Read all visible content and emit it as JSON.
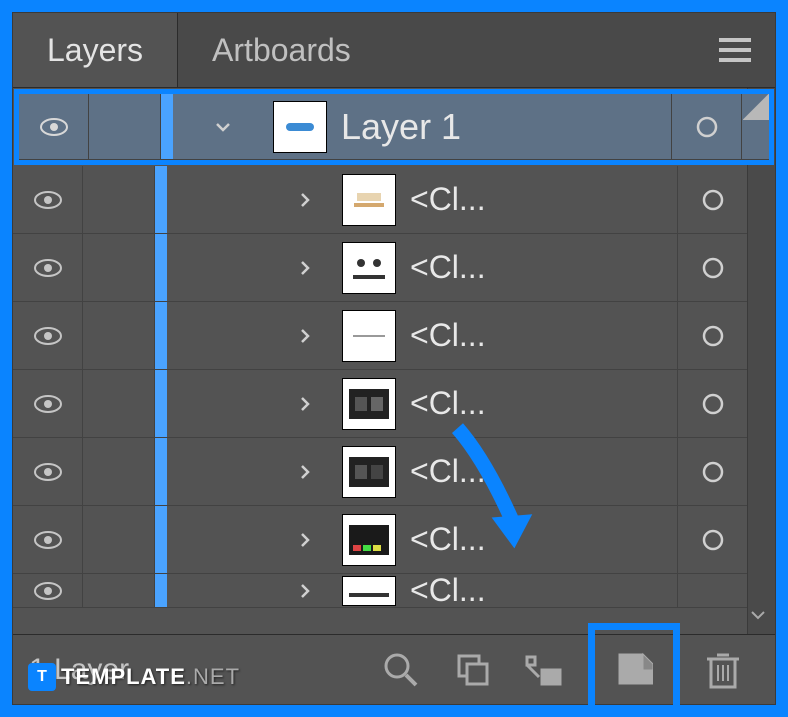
{
  "tabs": {
    "layers": "Layers",
    "artboards": "Artboards"
  },
  "layer": {
    "name": "Layer 1"
  },
  "items": [
    {
      "label": "<Cl..."
    },
    {
      "label": "<Cl..."
    },
    {
      "label": "<Cl..."
    },
    {
      "label": "<Cl..."
    },
    {
      "label": "<Cl..."
    },
    {
      "label": "<Cl..."
    },
    {
      "label": "<Cl..."
    }
  ],
  "footer": {
    "count": "1 Layer"
  },
  "watermark": {
    "logo": "T",
    "brand": "TEMPLATE",
    "suffix": ".NET"
  }
}
